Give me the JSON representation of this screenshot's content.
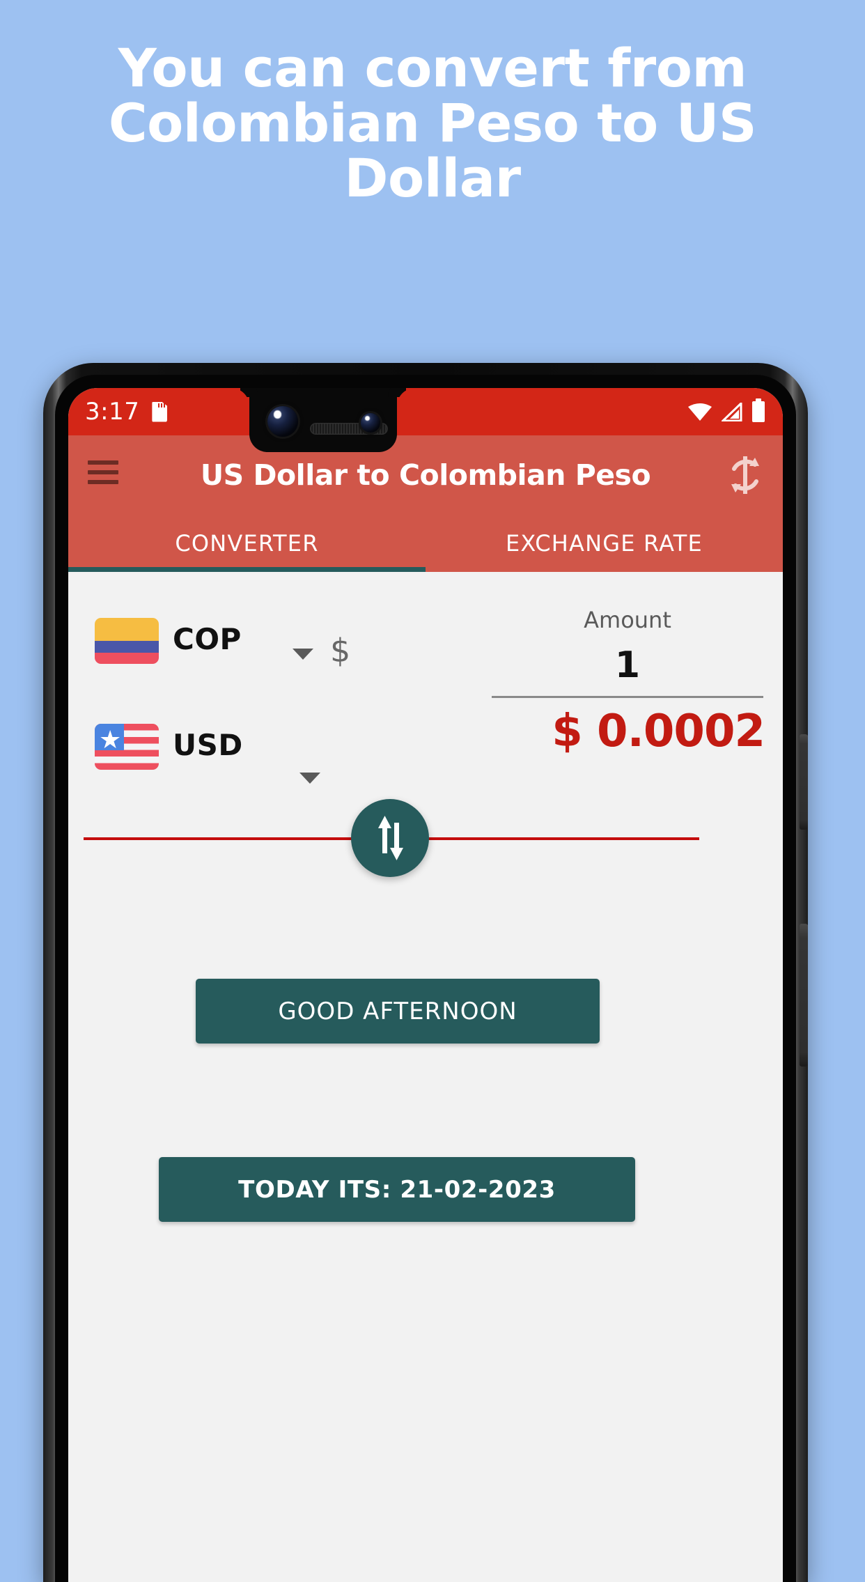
{
  "promo": {
    "headline": "You can convert from Colombian Peso to US Dollar"
  },
  "colors": {
    "page_background": "#9dc1f1",
    "status_bar_red": "#d32617",
    "app_bar_red": "#d05649",
    "accent_teal": "#265b5c",
    "result_red": "#c21b12",
    "divider_red": "#c40d0d",
    "screen_background": "#f2f2f2"
  },
  "status_bar": {
    "time": "3:17",
    "icons": {
      "storage": "sd-card-icon",
      "wifi": "wifi-icon",
      "signal": "cellular-signal-icon",
      "battery": "battery-full-icon"
    }
  },
  "app_bar": {
    "menu_icon": "hamburger-menu-icon",
    "title": "US Dollar to Colombian Peso",
    "refresh_icon": "refresh-swap-icon"
  },
  "tabs": [
    {
      "label": "CONVERTER",
      "active": true
    },
    {
      "label": "EXCHANGE RATE",
      "active": false
    }
  ],
  "converter": {
    "from": {
      "flag": "colombia-flag-icon",
      "code": "COP",
      "dropdown_icon": "chevron-down-icon",
      "currency_symbol": "$",
      "amount_label": "Amount",
      "amount_value": "1"
    },
    "to": {
      "flag": "usa-flag-icon",
      "code": "USD",
      "dropdown_icon": "chevron-down-icon",
      "result": "$ 0.0002"
    },
    "swap_icon": "swap-vertical-arrows-icon"
  },
  "actions": {
    "greeting_label": "GOOD AFTERNOON",
    "date_label": "TODAY ITS: 21-02-2023"
  }
}
